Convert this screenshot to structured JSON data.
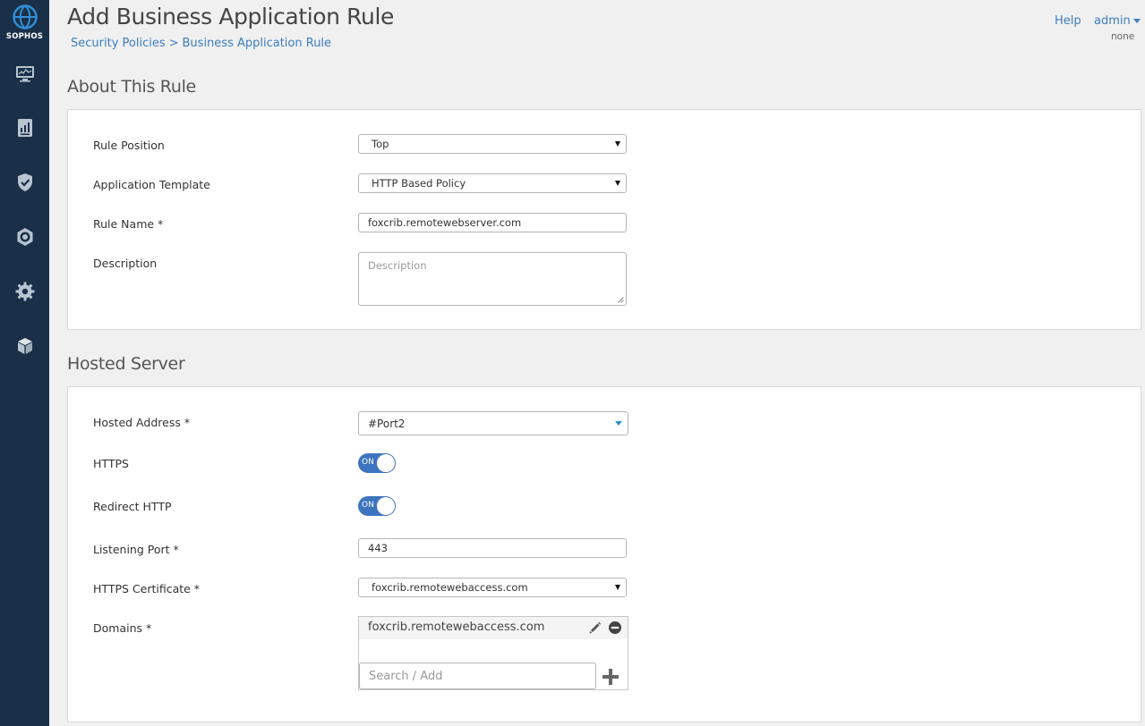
{
  "brand": {
    "name": "SOPHOS"
  },
  "sidebar": {
    "items": [
      {
        "name": "monitor-icon"
      },
      {
        "name": "reports-icon"
      },
      {
        "name": "shield-check-icon"
      },
      {
        "name": "protection-gear-icon"
      },
      {
        "name": "gear-icon"
      },
      {
        "name": "cube-icon"
      }
    ]
  },
  "header": {
    "title": "Add Business Application Rule",
    "breadcrumb": {
      "parent": "Security Policies",
      "separator": ">",
      "current": "Business Application Rule"
    },
    "help": "Help",
    "user": "admin",
    "user_sub": "none"
  },
  "about": {
    "heading": "About This Rule",
    "rule_position": {
      "label": "Rule Position",
      "value": "Top"
    },
    "application_template": {
      "label": "Application Template",
      "value": "HTTP Based Policy"
    },
    "rule_name": {
      "label": "Rule Name *",
      "value": "foxcrib.remotewebserver.com"
    },
    "description": {
      "label": "Description",
      "placeholder": "Description"
    }
  },
  "hosted": {
    "heading": "Hosted Server",
    "hosted_address": {
      "label": "Hosted Address *",
      "value": "#Port2"
    },
    "https": {
      "label": "HTTPS",
      "state": "ON"
    },
    "redirect_http": {
      "label": "Redirect HTTP",
      "state": "ON"
    },
    "listening_port": {
      "label": "Listening Port *",
      "value": "443"
    },
    "https_certificate": {
      "label": "HTTPS Certificate *",
      "value": "foxcrib.remotewebaccess.com"
    },
    "domains": {
      "label": "Domains *",
      "entries": [
        "foxcrib.remotewebaccess.com"
      ],
      "search_placeholder": "Search / Add"
    }
  },
  "colors": {
    "sidebar": "#1a3048",
    "accent": "#3b7dbf",
    "toggle_on": "#3d74bf"
  }
}
